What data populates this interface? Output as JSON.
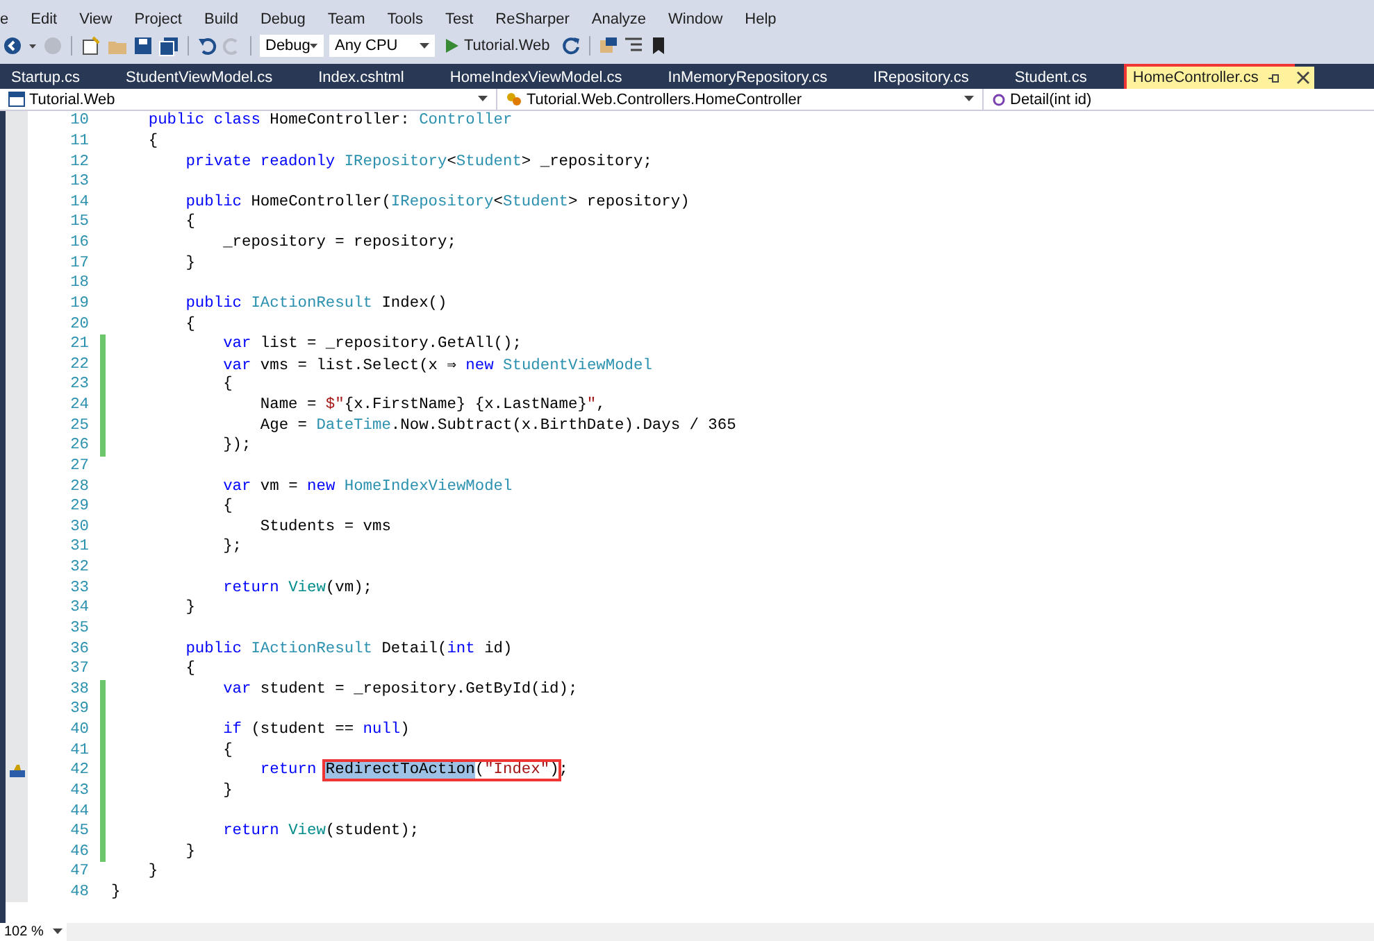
{
  "menu": [
    "e",
    "Edit",
    "View",
    "Project",
    "Build",
    "Debug",
    "Team",
    "Tools",
    "Test",
    "ReSharper",
    "Analyze",
    "Window",
    "Help"
  ],
  "toolbar": {
    "configuration": "Debug",
    "platform": "Any CPU",
    "run_target": "Tutorial.Web"
  },
  "tabs": [
    {
      "label": "Startup.cs",
      "selected": false,
      "annotated": false
    },
    {
      "label": "StudentViewModel.cs",
      "selected": false,
      "annotated": false
    },
    {
      "label": "Index.cshtml",
      "selected": false,
      "annotated": false
    },
    {
      "label": "HomeIndexViewModel.cs",
      "selected": false,
      "annotated": false
    },
    {
      "label": "InMemoryRepository.cs",
      "selected": false,
      "annotated": false
    },
    {
      "label": "IRepository.cs",
      "selected": false,
      "annotated": false
    },
    {
      "label": "Student.cs",
      "selected": false,
      "annotated": false
    },
    {
      "label": "HomeController.cs",
      "selected": true,
      "annotated": true
    }
  ],
  "navigation": {
    "project": "Tutorial.Web",
    "type": "Tutorial.Web.Controllers.HomeController",
    "member": "Detail(int id)"
  },
  "code_lines": [
    {
      "n": "10",
      "changed": false,
      "glyph": false,
      "tokens": [
        {
          "kind": "kw",
          "text": "    public class"
        },
        {
          "kind": "plain",
          "text": " HomeController: "
        },
        {
          "kind": "type",
          "text": "Controller"
        }
      ]
    },
    {
      "n": "11",
      "changed": false,
      "glyph": false,
      "tokens": [
        {
          "kind": "plain",
          "text": "    {"
        }
      ]
    },
    {
      "n": "12",
      "changed": false,
      "glyph": false,
      "tokens": [
        {
          "kind": "kw",
          "text": "        private readonly "
        },
        {
          "kind": "type",
          "text": "IRepository"
        },
        {
          "kind": "plain",
          "text": "<"
        },
        {
          "kind": "type",
          "text": "Student"
        },
        {
          "kind": "plain",
          "text": "> _repository;"
        }
      ]
    },
    {
      "n": "13",
      "changed": false,
      "glyph": false
    },
    {
      "n": "14",
      "changed": false,
      "glyph": false,
      "tokens": [
        {
          "kind": "kw",
          "text": "        public"
        },
        {
          "kind": "plain",
          "text": " HomeController("
        },
        {
          "kind": "type",
          "text": "IRepository"
        },
        {
          "kind": "plain",
          "text": "<"
        },
        {
          "kind": "type",
          "text": "Student"
        },
        {
          "kind": "plain",
          "text": "> repository)"
        }
      ]
    },
    {
      "n": "15",
      "changed": false,
      "glyph": false,
      "tokens": [
        {
          "kind": "plain",
          "text": "        {"
        }
      ]
    },
    {
      "n": "16",
      "changed": false,
      "glyph": false,
      "tokens": [
        {
          "kind": "plain",
          "text": "            _repository = repository;"
        }
      ]
    },
    {
      "n": "17",
      "changed": false,
      "glyph": false,
      "tokens": [
        {
          "kind": "plain",
          "text": "        }"
        }
      ]
    },
    {
      "n": "18",
      "changed": false,
      "glyph": false
    },
    {
      "n": "19",
      "changed": false,
      "glyph": false,
      "tokens": [
        {
          "kind": "kw",
          "text": "        public "
        },
        {
          "kind": "type",
          "text": "IActionResult"
        },
        {
          "kind": "plain",
          "text": " Index()"
        }
      ]
    },
    {
      "n": "20",
      "changed": false,
      "glyph": false,
      "tokens": [
        {
          "kind": "plain",
          "text": "        {"
        }
      ]
    },
    {
      "n": "21",
      "changed": true,
      "glyph": false,
      "tokens": [
        {
          "kind": "kw",
          "text": "            var"
        },
        {
          "kind": "plain",
          "text": " list = _repository.GetAll();"
        }
      ]
    },
    {
      "n": "22",
      "changed": true,
      "glyph": false,
      "tokens": [
        {
          "kind": "kw",
          "text": "            var"
        },
        {
          "kind": "plain",
          "text": " vms = list.Select(x ⇒ "
        },
        {
          "kind": "kw",
          "text": "new "
        },
        {
          "kind": "type",
          "text": "StudentViewModel"
        }
      ]
    },
    {
      "n": "23",
      "changed": true,
      "glyph": false,
      "tokens": [
        {
          "kind": "plain",
          "text": "            {"
        }
      ]
    },
    {
      "n": "24",
      "changed": true,
      "glyph": false,
      "tokens": [
        {
          "kind": "plain",
          "text": "                Name = "
        },
        {
          "kind": "str",
          "text": "$\""
        },
        {
          "kind": "plain",
          "text": "{x.FirstName} {x.LastName}"
        },
        {
          "kind": "str",
          "text": "\""
        },
        {
          "kind": "plain",
          "text": ","
        }
      ]
    },
    {
      "n": "25",
      "changed": true,
      "glyph": false,
      "tokens": [
        {
          "kind": "plain",
          "text": "                Age = "
        },
        {
          "kind": "type",
          "text": "DateTime"
        },
        {
          "kind": "plain",
          "text": ".Now.Subtract(x.BirthDate).Days / 365"
        }
      ]
    },
    {
      "n": "26",
      "changed": true,
      "glyph": false,
      "tokens": [
        {
          "kind": "plain",
          "text": "            });"
        }
      ]
    },
    {
      "n": "27",
      "changed": false,
      "glyph": false
    },
    {
      "n": "28",
      "changed": false,
      "glyph": false,
      "tokens": [
        {
          "kind": "kw",
          "text": "            var"
        },
        {
          "kind": "plain",
          "text": " vm = "
        },
        {
          "kind": "kw",
          "text": "new "
        },
        {
          "kind": "type",
          "text": "HomeIndexViewModel"
        }
      ]
    },
    {
      "n": "29",
      "changed": false,
      "glyph": false,
      "tokens": [
        {
          "kind": "plain",
          "text": "            {"
        }
      ]
    },
    {
      "n": "30",
      "changed": false,
      "glyph": false,
      "tokens": [
        {
          "kind": "plain",
          "text": "                Students = vms"
        }
      ]
    },
    {
      "n": "31",
      "changed": false,
      "glyph": false,
      "tokens": [
        {
          "kind": "plain",
          "text": "            };"
        }
      ]
    },
    {
      "n": "32",
      "changed": false,
      "glyph": false
    },
    {
      "n": "33",
      "changed": false,
      "glyph": false,
      "tokens": [
        {
          "kind": "kw",
          "text": "            return "
        },
        {
          "kind": "method",
          "text": "View"
        },
        {
          "kind": "plain",
          "text": "(vm);"
        }
      ]
    },
    {
      "n": "34",
      "changed": false,
      "glyph": false,
      "tokens": [
        {
          "kind": "plain",
          "text": "        }"
        }
      ]
    },
    {
      "n": "35",
      "changed": false,
      "glyph": false
    },
    {
      "n": "36",
      "changed": false,
      "glyph": false,
      "tokens": [
        {
          "kind": "kw",
          "text": "        public "
        },
        {
          "kind": "type",
          "text": "IActionResult"
        },
        {
          "kind": "plain",
          "text": " Detail("
        },
        {
          "kind": "kw",
          "text": "int"
        },
        {
          "kind": "plain",
          "text": " id)"
        }
      ]
    },
    {
      "n": "37",
      "changed": false,
      "glyph": false,
      "tokens": [
        {
          "kind": "plain",
          "text": "        {"
        }
      ]
    },
    {
      "n": "38",
      "changed": true,
      "glyph": false,
      "tokens": [
        {
          "kind": "kw",
          "text": "            var"
        },
        {
          "kind": "plain",
          "text": " student = _repository.GetById(id);"
        }
      ]
    },
    {
      "n": "39",
      "changed": true,
      "glyph": false
    },
    {
      "n": "40",
      "changed": true,
      "glyph": false,
      "tokens": [
        {
          "kind": "kw",
          "text": "            if"
        },
        {
          "kind": "plain",
          "text": " (student == "
        },
        {
          "kind": "kw",
          "text": "null"
        },
        {
          "kind": "plain",
          "text": ")"
        }
      ]
    },
    {
      "n": "41",
      "changed": true,
      "glyph": false,
      "tokens": [
        {
          "kind": "plain",
          "text": "            {"
        }
      ]
    },
    {
      "n": "42",
      "changed": true,
      "glyph": true,
      "tokens": [
        {
          "kind": "kw",
          "text": "                return "
        },
        {
          "kind": "box",
          "tokens": [
            {
              "kind": "sel",
              "text": "RedirectToAction"
            },
            {
              "kind": "plain",
              "text": "("
            },
            {
              "kind": "str",
              "text": "\"Index\""
            },
            {
              "kind": "plain",
              "text": ")"
            }
          ]
        },
        {
          "kind": "plain",
          "text": ";"
        }
      ]
    },
    {
      "n": "43",
      "changed": true,
      "glyph": false,
      "tokens": [
        {
          "kind": "plain",
          "text": "            }"
        }
      ]
    },
    {
      "n": "44",
      "changed": true,
      "glyph": false
    },
    {
      "n": "45",
      "changed": true,
      "glyph": false,
      "tokens": [
        {
          "kind": "kw",
          "text": "            return "
        },
        {
          "kind": "method",
          "text": "View"
        },
        {
          "kind": "plain",
          "text": "(student);"
        }
      ]
    },
    {
      "n": "46",
      "changed": true,
      "glyph": false,
      "tokens": [
        {
          "kind": "plain",
          "text": "        }"
        }
      ]
    },
    {
      "n": "47",
      "changed": false,
      "glyph": false,
      "tokens": [
        {
          "kind": "plain",
          "text": "    }"
        }
      ]
    },
    {
      "n": "48",
      "changed": false,
      "glyph": false,
      "tokens": [
        {
          "kind": "plain",
          "text": "}"
        }
      ]
    }
  ],
  "zoom": "102 %"
}
